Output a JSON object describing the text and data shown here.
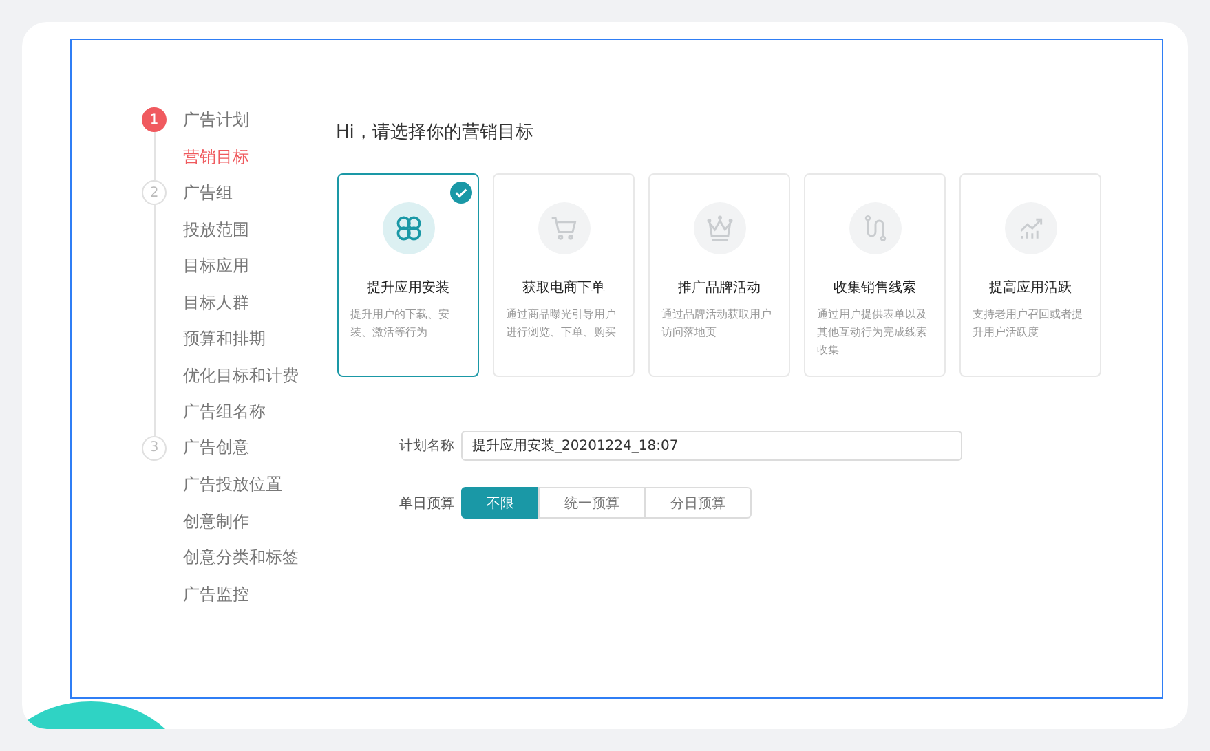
{
  "steps": [
    {
      "number": "1",
      "label": "广告计划",
      "active": true,
      "items": [
        {
          "label": "营销目标",
          "selected": true
        }
      ]
    },
    {
      "number": "2",
      "label": "广告组",
      "active": false,
      "items": [
        {
          "label": "投放范围",
          "selected": false
        },
        {
          "label": "目标应用",
          "selected": false
        },
        {
          "label": "目标人群",
          "selected": false
        },
        {
          "label": "预算和排期",
          "selected": false
        },
        {
          "label": "优化目标和计费",
          "selected": false
        },
        {
          "label": "广告组名称",
          "selected": false
        }
      ]
    },
    {
      "number": "3",
      "label": "广告创意",
      "active": false,
      "items": [
        {
          "label": "广告投放位置",
          "selected": false
        },
        {
          "label": "创意制作",
          "selected": false
        },
        {
          "label": "创意分类和标签",
          "selected": false
        },
        {
          "label": "广告监控",
          "selected": false
        }
      ]
    }
  ],
  "heading": "Hi，请选择你的营销目标",
  "goals": [
    {
      "kind": "app",
      "title": "提升应用安装",
      "description": "提升用户的下载、安装、激活等行为",
      "selected": true
    },
    {
      "kind": "cart",
      "title": "获取电商下单",
      "description": "通过商品曝光引导用户进行浏览、下单、购买",
      "selected": false
    },
    {
      "kind": "crown",
      "title": "推广品牌活动",
      "description": "通过品牌活动获取用户访问落地页",
      "selected": false
    },
    {
      "kind": "path",
      "title": "收集销售线索",
      "description": "通过用户提供表单以及其他互动行为完成线索收集",
      "selected": false
    },
    {
      "kind": "trend",
      "title": "提高应用活跃",
      "description": "支持老用户召回或者提升用户活跃度",
      "selected": false
    }
  ],
  "plan_name": {
    "label": "计划名称",
    "value": "提升应用安装_20201224_18:07"
  },
  "daily_budget": {
    "label": "单日预算",
    "options": [
      {
        "label": "不限",
        "selected": true
      },
      {
        "label": "统一预算",
        "selected": false
      },
      {
        "label": "分日预算",
        "selected": false
      }
    ]
  }
}
